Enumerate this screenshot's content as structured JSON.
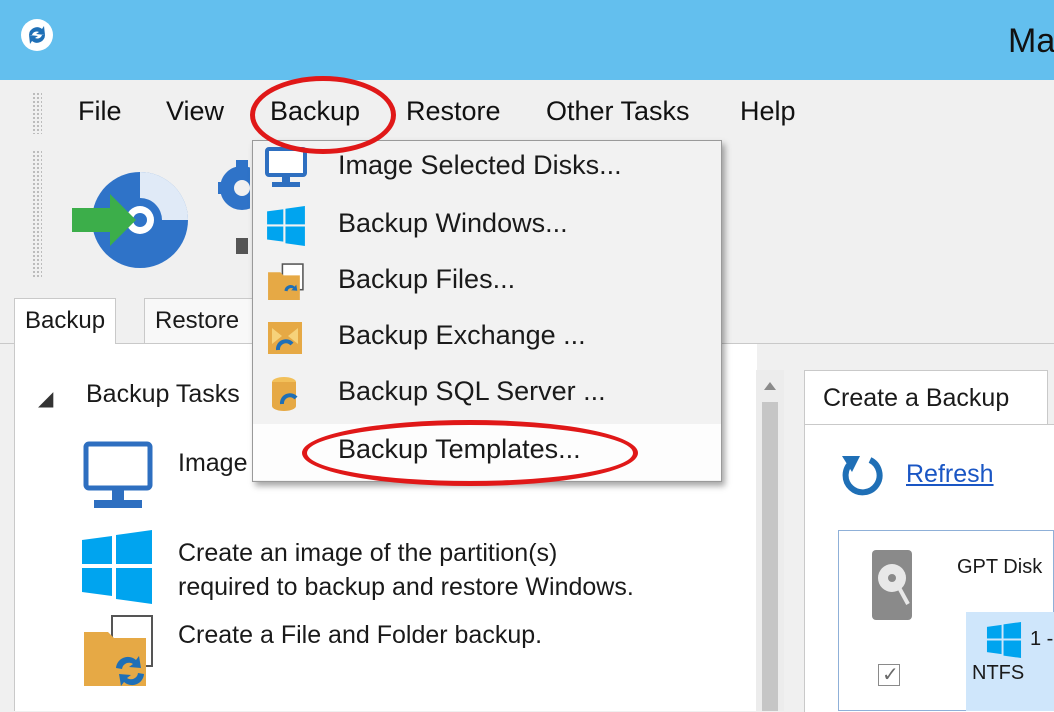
{
  "title": {
    "text": "Ma"
  },
  "menubar": {
    "items": [
      "File",
      "View",
      "Backup",
      "Restore",
      "Other Tasks",
      "Help"
    ]
  },
  "tabs": {
    "backup": "Backup",
    "restore": "Restore"
  },
  "backup_menu": {
    "items": [
      {
        "label": "Image Selected Disks...",
        "icon": "computer-icon"
      },
      {
        "label": "Backup Windows...",
        "icon": "windows-logo-icon"
      },
      {
        "label": "Backup Files...",
        "icon": "folder-sync-icon"
      },
      {
        "label": "Backup Exchange ...",
        "icon": "exchange-icon"
      },
      {
        "label": "Backup SQL Server ...",
        "icon": "database-icon"
      },
      {
        "label": "Backup Templates...",
        "icon": ""
      }
    ]
  },
  "left_pane": {
    "section_title": "Backup Tasks",
    "tasks": [
      {
        "text": "Image",
        "icon": "computer-icon"
      },
      {
        "text": "Create an image of the partition(s)\nrequired to backup and restore Windows.",
        "line1": "Create an image of the partition(s)",
        "line2": "required to backup and restore Windows.",
        "icon": "windows-logo-icon"
      },
      {
        "text": "Create a File and Folder backup.",
        "icon": "folder-sync-icon"
      }
    ]
  },
  "right_pane": {
    "tab_label": "Create a Backup",
    "refresh_label": "Refresh",
    "disk_label": "GPT Disk",
    "partition_number": "1 -",
    "partition_fs": "NTFS"
  },
  "colors": {
    "titlebar": "#63bfee",
    "annotation_red": "#e01818",
    "link_blue": "#1a56c4",
    "windows_blue": "#00a4ef"
  }
}
